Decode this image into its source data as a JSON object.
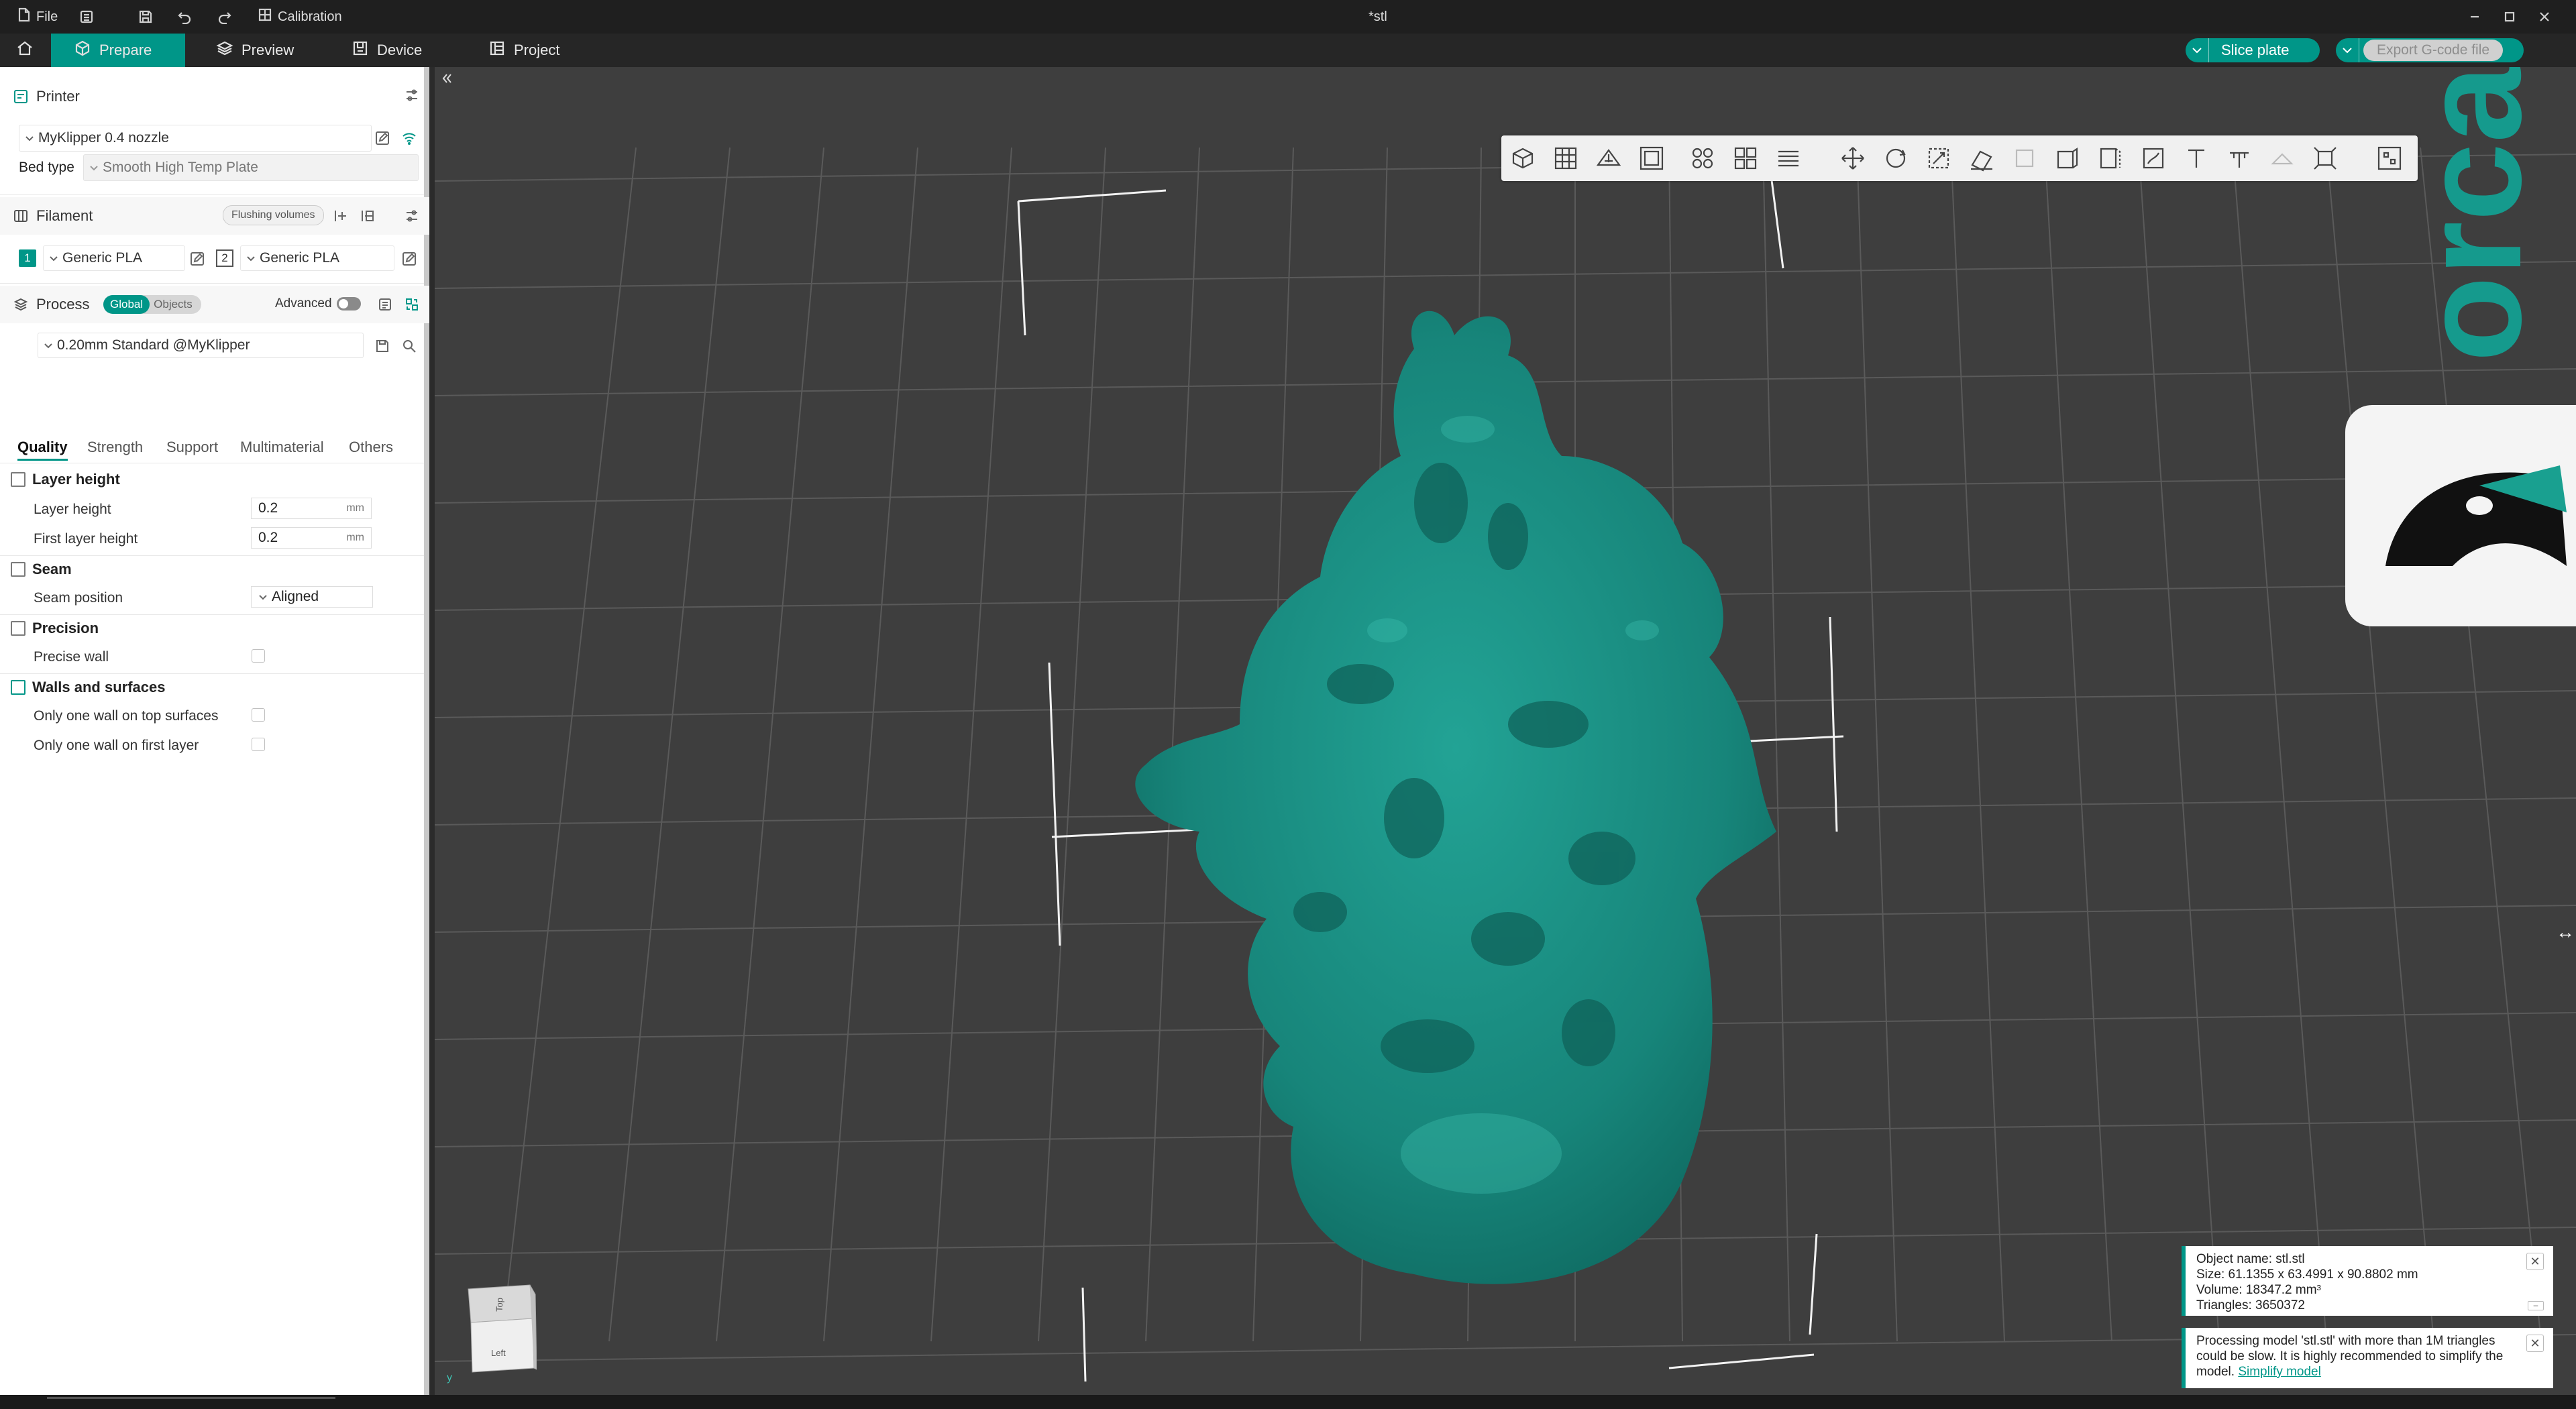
{
  "window": {
    "title": "*stl",
    "menu_file": "File",
    "calibration": "Calibration"
  },
  "tabs": {
    "prepare": "Prepare",
    "preview": "Preview",
    "device": "Device",
    "project": "Project"
  },
  "actions": {
    "slice_plate": "Slice plate",
    "export_gcode": "Export G-code file"
  },
  "colors": {
    "accent": "#009688",
    "model": "#1b8f83",
    "viewport_bg": "#3e3e3e"
  },
  "sidebar": {
    "printer": {
      "title": "Printer",
      "selected": "MyKlipper 0.4 nozzle",
      "bed_type_label": "Bed type",
      "bed_type_value": "Smooth High Temp Plate"
    },
    "filament": {
      "title": "Filament",
      "flushing_button": "Flushing volumes",
      "slots": [
        {
          "index": "1",
          "name": "Generic PLA"
        },
        {
          "index": "2",
          "name": "Generic PLA"
        }
      ]
    },
    "process": {
      "title": "Process",
      "toggle_global": "Global",
      "toggle_objects": "Objects",
      "advanced_label": "Advanced",
      "preset": "0.20mm Standard @MyKlipper"
    },
    "subtabs": [
      "Quality",
      "Strength",
      "Support",
      "Multimaterial",
      "Others"
    ],
    "groups": {
      "layer_height": {
        "title": "Layer height",
        "layer_height_label": "Layer height",
        "layer_height_value": "0.2",
        "first_layer_label": "First layer height",
        "first_layer_value": "0.2",
        "unit": "mm"
      },
      "seam": {
        "title": "Seam",
        "position_label": "Seam position",
        "position_value": "Aligned"
      },
      "precision": {
        "title": "Precision",
        "precise_wall_label": "Precise wall"
      },
      "walls": {
        "title": "Walls and surfaces",
        "top_label": "Only one wall on top surfaces",
        "first_label": "Only one wall on first layer"
      }
    }
  },
  "viewport": {
    "nav_cube": {
      "top": "Top",
      "left": "Left"
    },
    "axis_y": "y",
    "brand": "orca slicer"
  },
  "notifications": {
    "object_info": {
      "name": "Object name: stl.stl",
      "size": "Size: 61.1355 x 63.4991 x 90.8802 mm",
      "volume": "Volume: 18347.2 mm³",
      "triangles": "Triangles: 3650372"
    },
    "warning": {
      "text": "Processing model 'stl.stl' with more than 1M triangles could be slow. It is highly recommended to simplify the model.",
      "link": "Simplify model"
    }
  }
}
